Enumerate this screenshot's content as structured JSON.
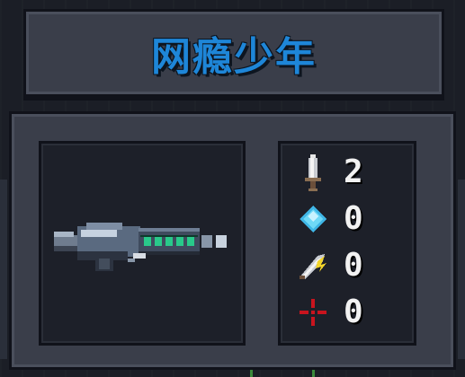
{
  "title": "网瘾少年",
  "weapon": {
    "icon": "assault-rifle-icon"
  },
  "stats": [
    {
      "name": "attack",
      "icon": "sword-icon",
      "value": "2"
    },
    {
      "name": "energy",
      "icon": "diamond-icon",
      "value": "0"
    },
    {
      "name": "critical",
      "icon": "lightning-blade-icon",
      "value": "0"
    },
    {
      "name": "spread",
      "icon": "crosshair-icon",
      "value": "0"
    }
  ],
  "colors": {
    "title": "#1e86d8",
    "panel": "#3a3e4a",
    "slot": "#1d2029",
    "energy": "#5fd8f5",
    "crosshair": "#c8141e"
  }
}
